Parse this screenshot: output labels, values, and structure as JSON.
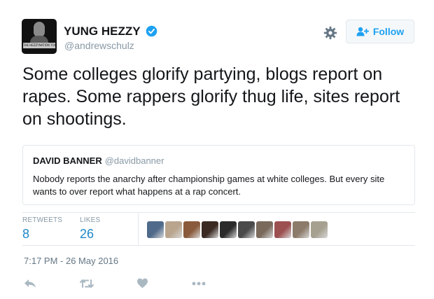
{
  "author": {
    "name": "YUNG HEZZY",
    "handle": "@andrewschulz",
    "avatar_caption": "THE HEZZYNATION TOUR",
    "verified": true
  },
  "header": {
    "follow_label": "Follow",
    "settings_icon": "gear-icon",
    "follow_icon": "person-plus-icon"
  },
  "tweet": {
    "text": "Some colleges glorify partying, blogs report on rapes. Some rappers glorify thug life, sites report on shootings."
  },
  "quote": {
    "name": "DAVID BANNER",
    "handle": "@davidbanner",
    "text": "Nobody reports the anarchy after championship games at white colleges. But every site wants to over report what happens at a rap concert."
  },
  "stats": {
    "retweets_label": "RETWEETS",
    "retweets": "8",
    "likes_label": "LIKES",
    "likes": "26"
  },
  "likers": [
    {
      "color": "#4f6a8a"
    },
    {
      "color": "#b9a58e"
    },
    {
      "color": "#8a5a3c"
    },
    {
      "color": "#3a2a22"
    },
    {
      "color": "#2b2b2b"
    },
    {
      "color": "#4a4a4a"
    },
    {
      "color": "#7a6a5c"
    },
    {
      "color": "#9c5050"
    },
    {
      "color": "#8c7b6a"
    },
    {
      "color": "#a6a090"
    }
  ],
  "timestamp": "7:17 PM - 26 May 2016",
  "actions": {
    "reply_icon": "reply-icon",
    "retweet_icon": "retweet-icon",
    "like_icon": "heart-icon",
    "more_icon": "more-icon"
  },
  "colors": {
    "accent": "#1da1f2",
    "stat_value": "#1d88c9",
    "muted": "#8899a6",
    "border": "#e1e8ed"
  }
}
